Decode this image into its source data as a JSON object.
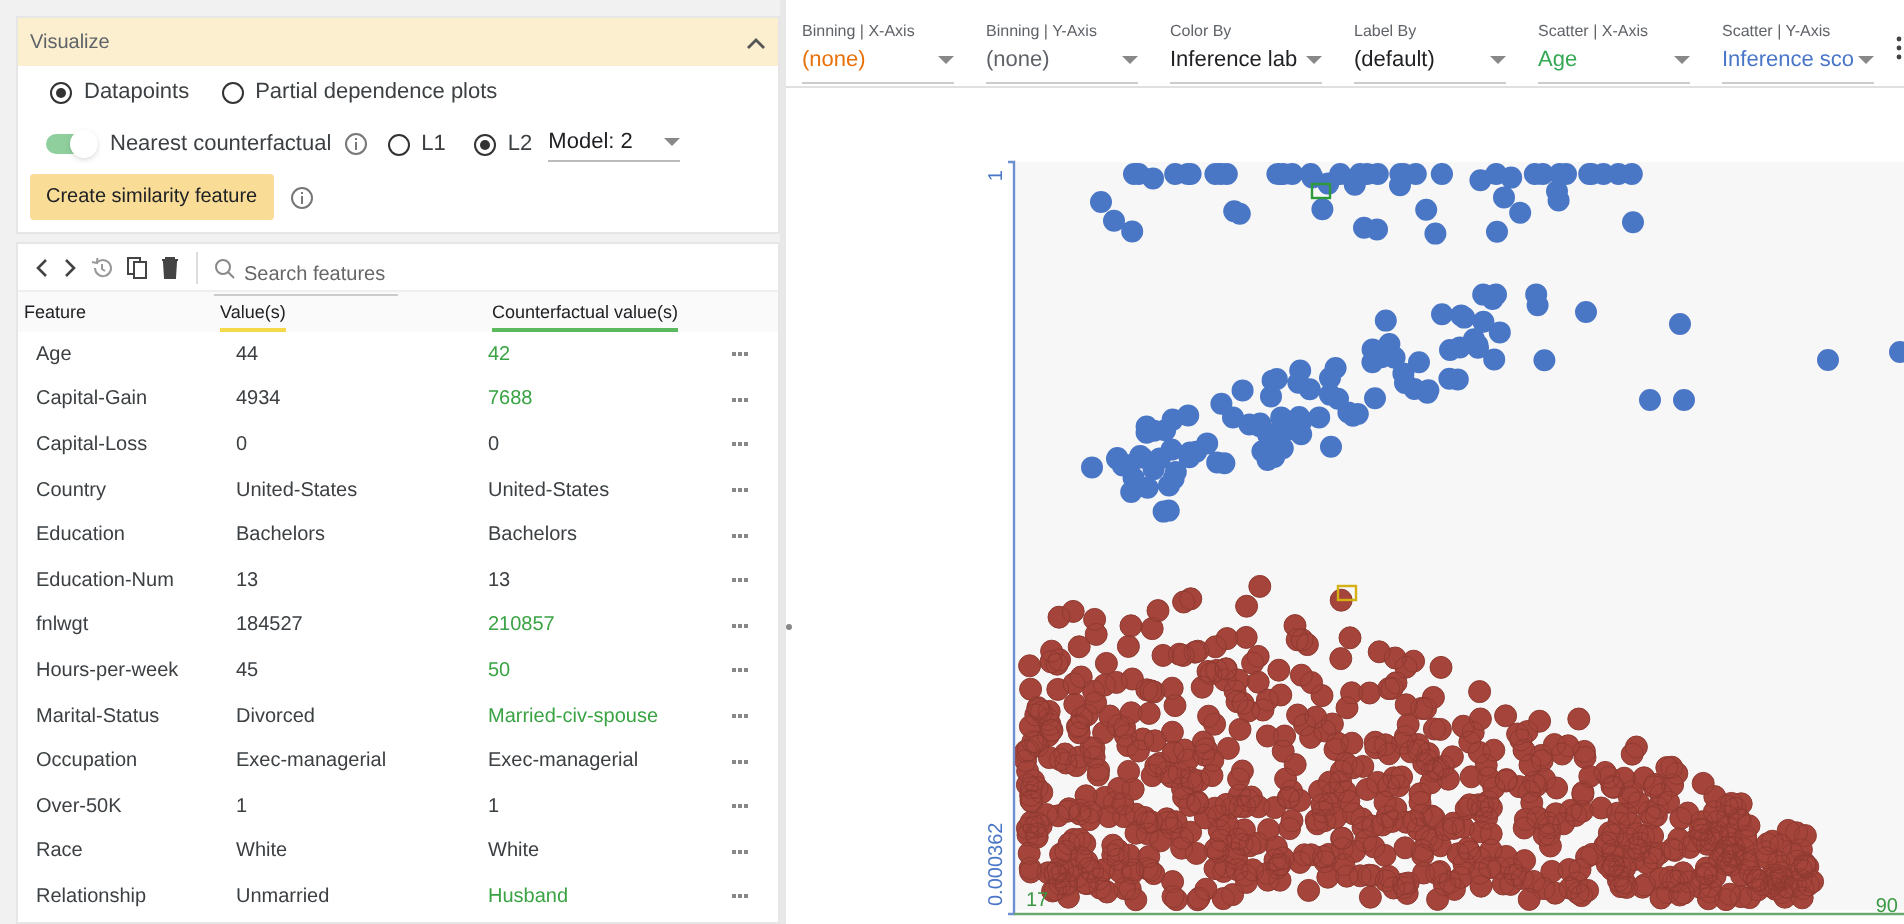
{
  "visualize": {
    "title": "Visualize",
    "expanded": true,
    "modes": [
      {
        "label": "Datapoints",
        "selected": true
      },
      {
        "label": "Partial dependence plots",
        "selected": false
      }
    ],
    "counterfactual": {
      "label": "Nearest counterfactual",
      "on": true
    },
    "distance": [
      {
        "label": "L1",
        "selected": false
      },
      {
        "label": "L2",
        "selected": true
      }
    ],
    "model": {
      "value": "Model: 2"
    },
    "similarity_button": "Create similarity feature"
  },
  "feature_editor": {
    "search": {
      "placeholder": "Search features"
    },
    "columns": [
      "Feature",
      "Value(s)",
      "Counterfactual value(s)"
    ],
    "rows": [
      {
        "feature": "Age",
        "value": "44",
        "counterfactual": "42",
        "changed": true
      },
      {
        "feature": "Capital-Gain",
        "value": "4934",
        "counterfactual": "7688",
        "changed": true
      },
      {
        "feature": "Capital-Loss",
        "value": "0",
        "counterfactual": "0",
        "changed": false
      },
      {
        "feature": "Country",
        "value": "United-States",
        "counterfactual": "United-States",
        "changed": false
      },
      {
        "feature": "Education",
        "value": "Bachelors",
        "counterfactual": "Bachelors",
        "changed": false
      },
      {
        "feature": "Education-Num",
        "value": "13",
        "counterfactual": "13",
        "changed": false
      },
      {
        "feature": "fnlwgt",
        "value": "184527",
        "counterfactual": "210857",
        "changed": true
      },
      {
        "feature": "Hours-per-week",
        "value": "45",
        "counterfactual": "50",
        "changed": true
      },
      {
        "feature": "Marital-Status",
        "value": "Divorced",
        "counterfactual": "Married-civ-spouse",
        "changed": true
      },
      {
        "feature": "Occupation",
        "value": "Exec-managerial",
        "counterfactual": "Exec-managerial",
        "changed": false
      },
      {
        "feature": "Over-50K",
        "value": "1",
        "counterfactual": "1",
        "changed": false
      },
      {
        "feature": "Race",
        "value": "White",
        "counterfactual": "White",
        "changed": false
      },
      {
        "feature": "Relationship",
        "value": "Unmarried",
        "counterfactual": "Husband",
        "changed": true
      }
    ]
  },
  "plot_controls": [
    {
      "label": "Binning | X-Axis",
      "value": "(none)",
      "color": "#e8710a"
    },
    {
      "label": "Binning | Y-Axis",
      "value": "(none)",
      "color": "#5f6368"
    },
    {
      "label": "Color By",
      "value": "Inference lab",
      "color": "#202124"
    },
    {
      "label": "Label By",
      "value": "(default)",
      "color": "#202124"
    },
    {
      "label": "Scatter | X-Axis",
      "value": "Age",
      "color": "#34a853"
    },
    {
      "label": "Scatter | Y-Axis",
      "value": "Inference sco",
      "color": "#4a76c8"
    }
  ],
  "plot": {
    "y_max": "1",
    "y_min": "0.000362",
    "x_min": "17",
    "x_max": "90"
  }
}
